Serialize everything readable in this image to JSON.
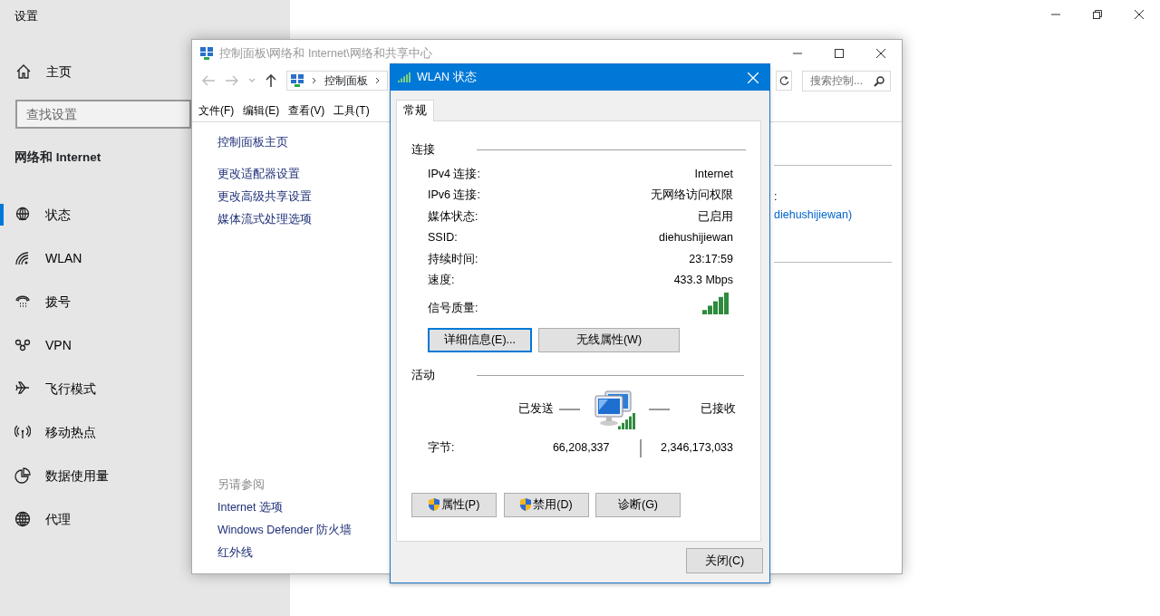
{
  "settings": {
    "title": "设置",
    "home": "主页",
    "search_placeholder": "查找设置",
    "section_title": "网络和 Internet",
    "nav": [
      {
        "label": "状态",
        "selected": true
      },
      {
        "label": "WLAN",
        "selected": false
      },
      {
        "label": "拨号",
        "selected": false
      },
      {
        "label": "VPN",
        "selected": false
      },
      {
        "label": "飞行模式",
        "selected": false
      },
      {
        "label": "移动热点",
        "selected": false
      },
      {
        "label": "数据使用量",
        "selected": false
      },
      {
        "label": "代理",
        "selected": false
      }
    ]
  },
  "control_panel": {
    "title": "控制面板\\网络和 Internet\\网络和共享中心",
    "breadcrumb": [
      "控制面板"
    ],
    "search_placeholder": "搜索控制...",
    "menu": [
      "文件(F)",
      "编辑(E)",
      "查看(V)",
      "工具(T)"
    ],
    "links": [
      "控制面板主页",
      "更改适配器设置",
      "更改高级共享设置",
      "媒体流式处理选项"
    ],
    "see_also_title": "另请参阅",
    "see_also": [
      "Internet 选项",
      "Windows Defender 防火墙",
      "红外线"
    ],
    "fragments": [
      ":",
      "diehushijiewan)"
    ]
  },
  "wlan_dialog": {
    "title": "WLAN 状态",
    "tabs": [
      {
        "label": "常规",
        "selected": true
      }
    ],
    "connection_title": "连接",
    "rows": [
      {
        "label": "IPv4 连接:",
        "value": "Internet"
      },
      {
        "label": "IPv6 连接:",
        "value": "无网络访问权限"
      },
      {
        "label": "媒体状态:",
        "value": "已启用"
      },
      {
        "label": "SSID:",
        "value": "diehushijiewan"
      },
      {
        "label": "持续时间:",
        "value": "23:17:59"
      },
      {
        "label": "速度:",
        "value": "433.3 Mbps"
      }
    ],
    "signal_label": "信号质量:",
    "buttons": [
      {
        "label": "详细信息(E)...",
        "focused": true
      },
      {
        "label": "无线属性(W)",
        "focused": false
      }
    ],
    "activity_title": "活动",
    "sent_label": "已发送",
    "received_label": "已接收",
    "bytes_label": "字节:",
    "bytes_sent": "66,208,337",
    "bytes_received": "2,346,173,033",
    "actions": [
      {
        "label": "属性(P)",
        "shield": true
      },
      {
        "label": "禁用(D)",
        "shield": true
      },
      {
        "label": "诊断(G)",
        "shield": false
      }
    ],
    "close_button": "关闭(C)"
  }
}
